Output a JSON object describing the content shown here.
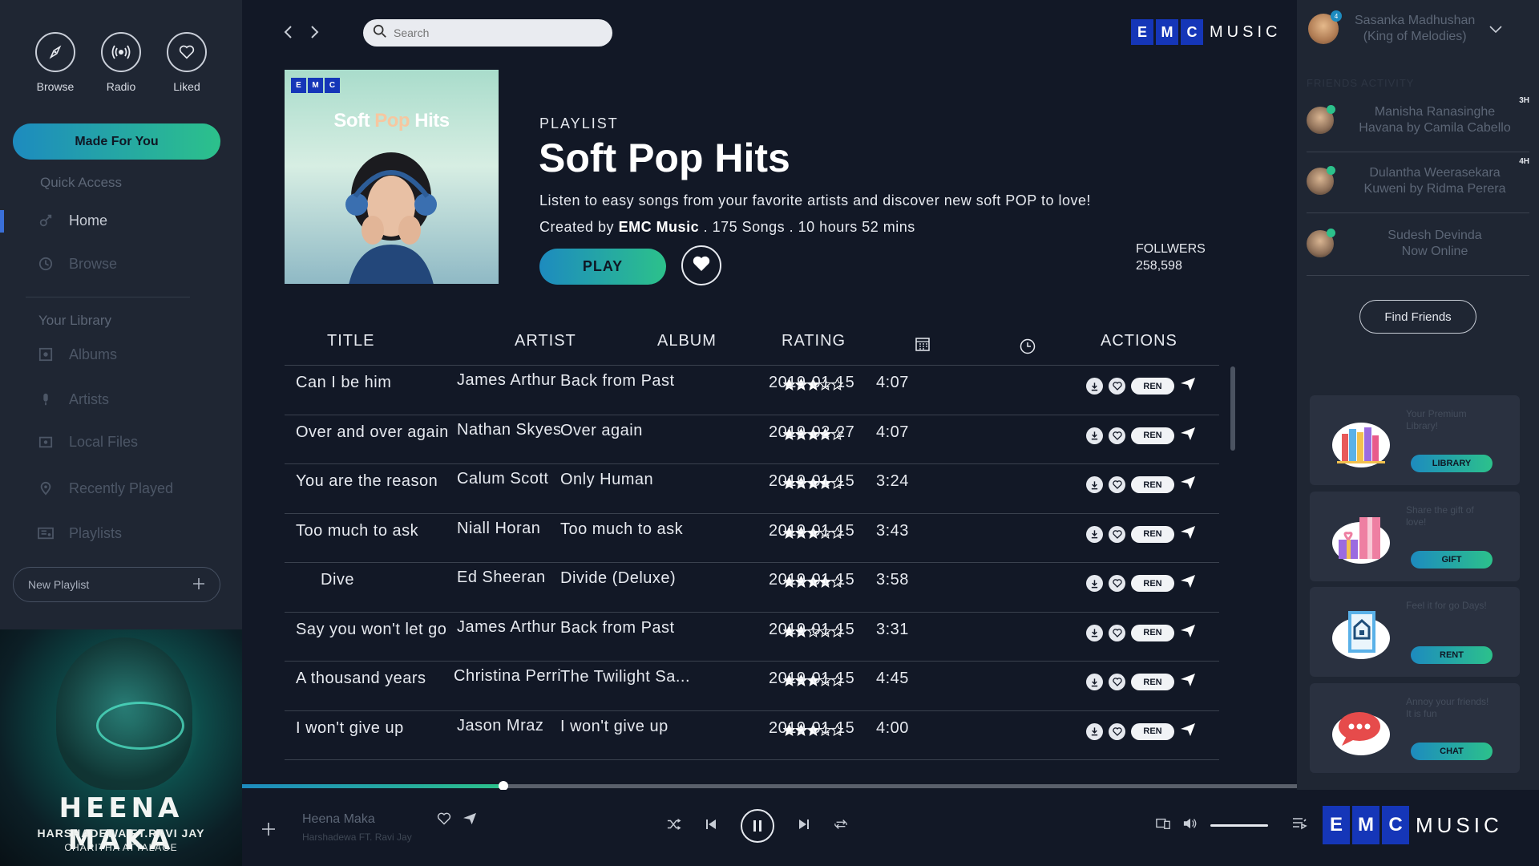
{
  "app": {
    "brand_letters": [
      "E",
      "M",
      "C"
    ],
    "brand_word": "MUSIC",
    "accent": "#2cc18b",
    "accent2": "#1d8bbf",
    "brand_blue": "#1536b8"
  },
  "top_nav": [
    {
      "label": "Browse",
      "icon": "compass-icon"
    },
    {
      "label": "Radio",
      "icon": "radio-icon"
    },
    {
      "label": "Liked",
      "icon": "heart-icon"
    }
  ],
  "sidebar": {
    "made_for_you": "Made For You",
    "quick_access_title": "Quick Access",
    "quick_access": [
      {
        "label": "Home",
        "icon": "satellite-icon"
      },
      {
        "label": "Browse",
        "icon": "clock-icon"
      }
    ],
    "library_title": "Your Library",
    "library": [
      {
        "label": "Albums",
        "icon": "album-icon"
      },
      {
        "label": "Artists",
        "icon": "mic-icon"
      },
      {
        "label": "Local Files",
        "icon": "folder-icon"
      },
      {
        "label": "Recently Played",
        "icon": "location-icon"
      },
      {
        "label": "Playlists",
        "icon": "playlist-icon"
      }
    ],
    "new_playlist": "New Playlist"
  },
  "now_playing_art": {
    "title": "HEENA MAKA",
    "line1": "HARSHADEWA FT.RAVI JAY",
    "line2": "CHARITHA ATTALAGE"
  },
  "header": {
    "search_placeholder": "Search"
  },
  "playlist": {
    "cover_title_part1": "Soft ",
    "cover_title_part2": "Pop",
    "cover_title_part3": " Hits",
    "label": "PLAYLIST",
    "title": "Soft Pop Hits",
    "description": "Listen to easy songs from your favorite artists and discover new soft POP to love!",
    "created_by_prefix": "Created by ",
    "creator": "EMC Music",
    "meta_suffix": " . 175 Songs . 10 hours 52 mins",
    "play_label": "PLAY",
    "followers_label": "FOLLWERS",
    "followers_count": "258,598"
  },
  "table": {
    "headers": {
      "title": "TITLE",
      "artist": "ARTIST",
      "album": "ALBUM",
      "rating": "RATING",
      "date_icon": "calendar-icon",
      "time_icon": "clock-icon",
      "actions": "ACTIONS"
    },
    "ren_label": "REN",
    "rows": [
      {
        "title": "Can I be him",
        "artist": "James Arthur",
        "album": "Back from Past",
        "rating": 3,
        "date": "2019-01-15",
        "time": "4:07"
      },
      {
        "title": "Over and over again",
        "artist": "Nathan Skyes",
        "album": "Over again",
        "rating": 4,
        "date": "2019-02-27",
        "time": "4:07"
      },
      {
        "title": "You are the reason",
        "artist": "Calum Scott",
        "album": "Only Human",
        "rating": 4,
        "date": "2019-01-15",
        "time": "3:24"
      },
      {
        "title": "Too much to ask",
        "artist": "Niall Horan",
        "album": "Too much to ask",
        "rating": 3,
        "date": "2019-01-15",
        "time": "3:43"
      },
      {
        "title": "Dive",
        "artist": "Ed Sheeran",
        "album": "Divide (Deluxe)",
        "rating": 4,
        "date": "2019-01-15",
        "time": "3:58"
      },
      {
        "title": "Say you won't let go",
        "artist": "James Arthur",
        "album": "Back from Past",
        "rating": 2,
        "date": "2019-01-15",
        "time": "3:31"
      },
      {
        "title": "A thousand years",
        "artist": "Christina Perri",
        "album": "The Twilight Sa...",
        "rating": 3,
        "date": "2019-01-15",
        "time": "4:45"
      },
      {
        "title": "I won't give up",
        "artist": "Jason Mraz",
        "album": "I won't give up",
        "rating": 3,
        "date": "2019-01-15",
        "time": "4:00"
      }
    ]
  },
  "player": {
    "progress": 0.248,
    "song": "Heena Maka",
    "artist": "Harshadewa FT. Ravi Jay",
    "volume": 1.0
  },
  "right_panel": {
    "user_name": "Sasanka Madhushan",
    "user_subtitle": "(King of Melodies)",
    "notification_count": "4",
    "friends_title": "FRIENDS ACTIVITY",
    "friends": [
      {
        "name": "Manisha Ranasinghe",
        "activity": "Havana by Camila Cabello",
        "time": "3H"
      },
      {
        "name": "Dulantha Weerasekara",
        "activity": "Kuweni by Ridma Perera",
        "time": "4H"
      },
      {
        "name": "Sudesh Devinda",
        "activity": "Now Online",
        "time": ""
      }
    ],
    "find_friends": "Find Friends",
    "promos": [
      {
        "text": "Your Premium Library!",
        "button": "LIBRARY",
        "icon": "books-icon"
      },
      {
        "text": "Share the gift of love!",
        "button": "GIFT",
        "icon": "gift-icon"
      },
      {
        "text": "Feel it for go Days!",
        "button": "RENT",
        "icon": "rent-icon"
      },
      {
        "text": "Annoy your friends! It is fun",
        "button": "CHAT",
        "icon": "chat-bubble-icon"
      }
    ]
  }
}
